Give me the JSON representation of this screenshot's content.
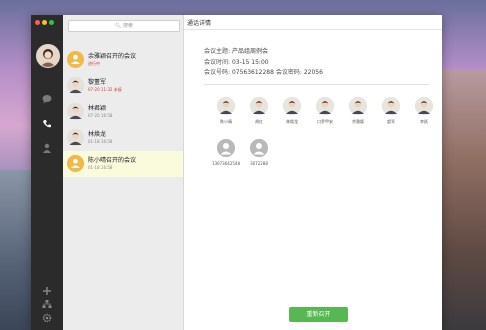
{
  "search": {
    "placeholder": "搜索"
  },
  "conversations": [
    {
      "name": "余雅颖召开的会议",
      "sub": "进行中",
      "sub_red": true,
      "type": "conference"
    },
    {
      "name": "黎董军",
      "sub": "07-20 11:32 未接",
      "sub_red": true,
      "type": "person"
    },
    {
      "name": "林君颖",
      "sub": "07-20 16:58",
      "sub_red": false,
      "type": "person"
    },
    {
      "name": "林焕龙",
      "sub": "01-18 16:58",
      "sub_red": false,
      "type": "person"
    },
    {
      "name": "陈小晴召开的会议",
      "sub": "01-18 16:58",
      "sub_red": false,
      "type": "conference"
    }
  ],
  "detail": {
    "title": "通话详情",
    "topic_label": "会议主题:",
    "topic_value": "产品组周例会",
    "time_label": "会议时间:",
    "time_value": "03-15 15:00",
    "number_label": "会议号码:",
    "number_value": "07563612288",
    "pwd_label": "会议密码:",
    "pwd_value": "22056",
    "participants": [
      {
        "name": "陈小晴",
        "gray": false
      },
      {
        "name": "胡红",
        "gray": false
      },
      {
        "name": "林焕龙",
        "gray": false
      },
      {
        "name": "口罗甲安",
        "gray": false
      },
      {
        "name": "余雅颖",
        "gray": false
      },
      {
        "name": "超军",
        "gray": false
      },
      {
        "name": "李跃",
        "gray": false
      },
      {
        "name": "13673642548",
        "gray": true
      },
      {
        "name": "3072288",
        "gray": true
      }
    ],
    "restart_label": "重新召开"
  },
  "colors": {
    "accent": "#55b852",
    "sidebar": "#2b2b2b",
    "selected": "#fafadc",
    "conference": "#f0b94a"
  }
}
